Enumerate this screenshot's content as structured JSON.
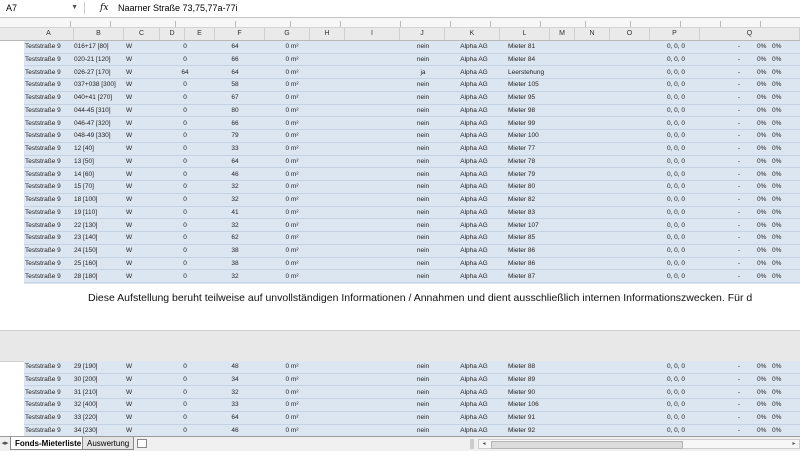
{
  "formula_bar": {
    "name_box": "A7",
    "fx_label": "fx",
    "formula": "Naarner Straße 73,75,77a-77i"
  },
  "column_headers": [
    "A",
    "B",
    "C",
    "D",
    "E",
    "F",
    "G",
    "H",
    "I",
    "J",
    "K",
    "L",
    "M",
    "N",
    "O",
    "P",
    "Q"
  ],
  "top_rows": [
    {
      "street": "Teststraße 9",
      "unit": "016+17 [80]",
      "type": "W",
      "e": "0",
      "f": "64",
      "g": "0 m²",
      "j": "nein",
      "k": "Alpha AG",
      "l": "Mieter 81",
      "p": "0, 0, 0",
      "q1": "-",
      "q2": "0%",
      "q3": "0%"
    },
    {
      "street": "Teststraße 9",
      "unit": "020-21 [120]",
      "type": "W",
      "e": "0",
      "f": "66",
      "g": "0 m²",
      "j": "nein",
      "k": "Alpha AG",
      "l": "Mieter 84",
      "p": "0, 0, 0",
      "q1": "-",
      "q2": "0%",
      "q3": "0%"
    },
    {
      "street": "Teststraße 9",
      "unit": "026-27 [170]",
      "type": "W",
      "e": "64",
      "f": "64",
      "g": "0 m²",
      "j": "ja",
      "k": "Alpha AG",
      "l": "Leerstehung",
      "p": "0, 0, 0",
      "q1": "-",
      "q2": "0%",
      "q3": "0%"
    },
    {
      "street": "Teststraße 9",
      "unit": "037+038 [300]",
      "type": "W",
      "e": "0",
      "f": "58",
      "g": "0 m²",
      "j": "nein",
      "k": "Alpha AG",
      "l": "Mieter 105",
      "p": "0, 0, 0",
      "q1": "-",
      "q2": "0%",
      "q3": "0%"
    },
    {
      "street": "Teststraße 9",
      "unit": "040+41 [270]",
      "type": "W",
      "e": "0",
      "f": "67",
      "g": "0 m²",
      "j": "nein",
      "k": "Alpha AG",
      "l": "Mieter 95",
      "p": "0, 0, 0",
      "q1": "-",
      "q2": "0%",
      "q3": "0%"
    },
    {
      "street": "Teststraße 9",
      "unit": "044-45 [310]",
      "type": "W",
      "e": "0",
      "f": "80",
      "g": "0 m²",
      "j": "nein",
      "k": "Alpha AG",
      "l": "Mieter 98",
      "p": "0, 0, 0",
      "q1": "-",
      "q2": "0%",
      "q3": "0%"
    },
    {
      "street": "Teststraße 9",
      "unit": "046-47 [320]",
      "type": "W",
      "e": "0",
      "f": "66",
      "g": "0 m²",
      "j": "nein",
      "k": "Alpha AG",
      "l": "Mieter 99",
      "p": "0, 0, 0",
      "q1": "-",
      "q2": "0%",
      "q3": "0%"
    },
    {
      "street": "Teststraße 9",
      "unit": "048-49 [330]",
      "type": "W",
      "e": "0",
      "f": "79",
      "g": "0 m²",
      "j": "nein",
      "k": "Alpha AG",
      "l": "Mieter 100",
      "p": "0, 0, 0",
      "q1": "-",
      "q2": "0%",
      "q3": "0%"
    },
    {
      "street": "Teststraße 9",
      "unit": "12 [40]",
      "type": "W",
      "e": "0",
      "f": "33",
      "g": "0 m²",
      "j": "nein",
      "k": "Alpha AG",
      "l": "Mieter 77",
      "p": "0, 0, 0",
      "q1": "-",
      "q2": "0%",
      "q3": "0%"
    },
    {
      "street": "Teststraße 9",
      "unit": "13 [50]",
      "type": "W",
      "e": "0",
      "f": "64",
      "g": "0 m²",
      "j": "nein",
      "k": "Alpha AG",
      "l": "Mieter 78",
      "p": "0, 0, 0",
      "q1": "-",
      "q2": "0%",
      "q3": "0%"
    },
    {
      "street": "Teststraße 9",
      "unit": "14 [60]",
      "type": "W",
      "e": "0",
      "f": "46",
      "g": "0 m²",
      "j": "nein",
      "k": "Alpha AG",
      "l": "Mieter 79",
      "p": "0, 0, 0",
      "q1": "-",
      "q2": "0%",
      "q3": "0%"
    },
    {
      "street": "Teststraße 9",
      "unit": "15 [70]",
      "type": "W",
      "e": "0",
      "f": "32",
      "g": "0 m²",
      "j": "nein",
      "k": "Alpha AG",
      "l": "Mieter 80",
      "p": "0, 0, 0",
      "q1": "-",
      "q2": "0%",
      "q3": "0%"
    },
    {
      "street": "Teststraße 9",
      "unit": "18 [100]",
      "type": "W",
      "e": "0",
      "f": "32",
      "g": "0 m²",
      "j": "nein",
      "k": "Alpha AG",
      "l": "Mieter 82",
      "p": "0, 0, 0",
      "q1": "-",
      "q2": "0%",
      "q3": "0%"
    },
    {
      "street": "Teststraße 9",
      "unit": "19 [110]",
      "type": "W",
      "e": "0",
      "f": "41",
      "g": "0 m²",
      "j": "nein",
      "k": "Alpha AG",
      "l": "Mieter 83",
      "p": "0, 0, 0",
      "q1": "-",
      "q2": "0%",
      "q3": "0%"
    },
    {
      "street": "Teststraße 9",
      "unit": "22 [130]",
      "type": "W",
      "e": "0",
      "f": "32",
      "g": "0 m²",
      "j": "nein",
      "k": "Alpha AG",
      "l": "Mieter 107",
      "p": "0, 0, 0",
      "q1": "-",
      "q2": "0%",
      "q3": "0%"
    },
    {
      "street": "Teststraße 9",
      "unit": "23 [140]",
      "type": "W",
      "e": "0",
      "f": "62",
      "g": "0 m²",
      "j": "nein",
      "k": "Alpha AG",
      "l": "Mieter 85",
      "p": "0, 0, 0",
      "q1": "-",
      "q2": "0%",
      "q3": "0%"
    },
    {
      "street": "Teststraße 9",
      "unit": "24 [150]",
      "type": "W",
      "e": "0",
      "f": "38",
      "g": "0 m²",
      "j": "nein",
      "k": "Alpha AG",
      "l": "Mieter 86",
      "p": "0, 0, 0",
      "q1": "-",
      "q2": "0%",
      "q3": "0%"
    },
    {
      "street": "Teststraße 9",
      "unit": "25 [160]",
      "type": "W",
      "e": "0",
      "f": "38",
      "g": "0 m²",
      "j": "nein",
      "k": "Alpha AG",
      "l": "Mieter 86",
      "p": "0, 0, 0",
      "q1": "-",
      "q2": "0%",
      "q3": "0%"
    },
    {
      "street": "Teststraße 9",
      "unit": "28 [180]",
      "type": "W",
      "e": "0",
      "f": "32",
      "g": "0 m²",
      "j": "nein",
      "k": "Alpha AG",
      "l": "Mieter 87",
      "p": "0, 0, 0",
      "q1": "-",
      "q2": "0%",
      "q3": "0%"
    }
  ],
  "disclaimer": "Diese Aufstellung beruht teilweise auf unvollständigen Informationen / Annahmen und dient ausschließlich internen Informationszwecken. Für d",
  "bottom_rows": [
    {
      "street": "Teststraße 9",
      "unit": "29 [190]",
      "type": "W",
      "e": "0",
      "f": "48",
      "g": "0 m²",
      "j": "nein",
      "k": "Alpha AG",
      "l": "Mieter 88",
      "p": "0, 0, 0",
      "q1": "-",
      "q2": "0%",
      "q3": "0%"
    },
    {
      "street": "Teststraße 9",
      "unit": "30 [200]",
      "type": "W",
      "e": "0",
      "f": "34",
      "g": "0 m²",
      "j": "nein",
      "k": "Alpha AG",
      "l": "Mieter 89",
      "p": "0, 0, 0",
      "q1": "-",
      "q2": "0%",
      "q3": "0%"
    },
    {
      "street": "Teststraße 9",
      "unit": "31 [210]",
      "type": "W",
      "e": "0",
      "f": "32",
      "g": "0 m²",
      "j": "nein",
      "k": "Alpha AG",
      "l": "Mieter 90",
      "p": "0, 0, 0",
      "q1": "-",
      "q2": "0%",
      "q3": "0%"
    },
    {
      "street": "Teststraße 9",
      "unit": "32 [400]",
      "type": "W",
      "e": "0",
      "f": "33",
      "g": "0 m²",
      "j": "nein",
      "k": "Alpha AG",
      "l": "Mieter 106",
      "p": "0, 0, 0",
      "q1": "-",
      "q2": "0%",
      "q3": "0%"
    },
    {
      "street": "Teststraße 9",
      "unit": "33 [220]",
      "type": "W",
      "e": "0",
      "f": "64",
      "g": "0 m²",
      "j": "nein",
      "k": "Alpha AG",
      "l": "Mieter 91",
      "p": "0, 0, 0",
      "q1": "-",
      "q2": "0%",
      "q3": "0%"
    },
    {
      "street": "Teststraße 9",
      "unit": "34 [230]",
      "type": "W",
      "e": "0",
      "f": "46",
      "g": "0 m²",
      "j": "nein",
      "k": "Alpha AG",
      "l": "Mieter 92",
      "p": "0, 0, 0",
      "q1": "-",
      "q2": "0%",
      "q3": "0%"
    }
  ],
  "sheet_tabs": [
    "Fonds-Mieterliste",
    "Auswertung"
  ],
  "colors": {
    "row_bg": "#dce6f1",
    "header_bg": "#eaeaea"
  }
}
